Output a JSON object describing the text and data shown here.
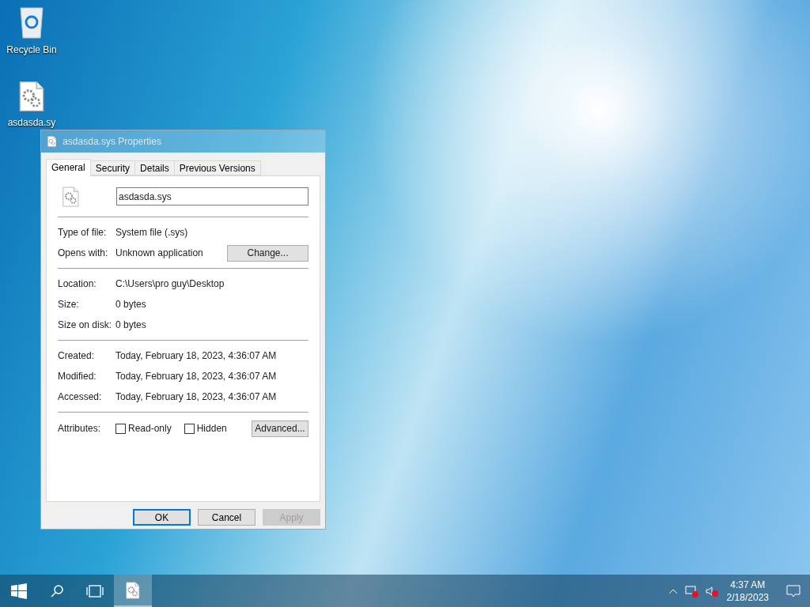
{
  "desktop_icons": [
    {
      "kind": "recycle",
      "label": "Recycle Bin"
    },
    {
      "kind": "file",
      "label": "asdasda.sy"
    }
  ],
  "window": {
    "title": "asdasda.sys Properties",
    "tabs": [
      {
        "label": "General",
        "selected": true
      },
      {
        "label": "Security",
        "selected": false
      },
      {
        "label": "Details",
        "selected": false
      },
      {
        "label": "Previous Versions",
        "selected": false
      }
    ],
    "file_name": "asdasda.sys",
    "type_rows": [
      {
        "label": "Type of file:",
        "value": "System file (.sys)"
      },
      {
        "label": "Opens with:",
        "value": "Unknown application",
        "button": "Change..."
      }
    ],
    "location_rows": [
      {
        "label": "Location:",
        "value": "C:\\Users\\pro guy\\Desktop"
      },
      {
        "label": "Size:",
        "value": "0 bytes"
      },
      {
        "label": "Size on disk:",
        "value": "0 bytes"
      }
    ],
    "date_rows": [
      {
        "label": "Created:",
        "value": "Today, February 18, 2023, 4:36:07 AM"
      },
      {
        "label": "Modified:",
        "value": "Today, February 18, 2023, 4:36:07 AM"
      },
      {
        "label": "Accessed:",
        "value": "Today, February 18, 2023, 4:36:07 AM"
      }
    ],
    "attributes": {
      "label": "Attributes:",
      "checkboxes": [
        {
          "label": "Read-only",
          "checked": false
        },
        {
          "label": "Hidden",
          "checked": false
        }
      ],
      "button": "Advanced..."
    },
    "buttons": [
      {
        "label": "OK",
        "disabled": false,
        "default": true
      },
      {
        "label": "Cancel",
        "disabled": false,
        "default": false
      },
      {
        "label": "Apply",
        "disabled": true,
        "default": false
      }
    ]
  },
  "taskbar": {
    "time": "4:37 AM",
    "date": "2/18/2023"
  }
}
